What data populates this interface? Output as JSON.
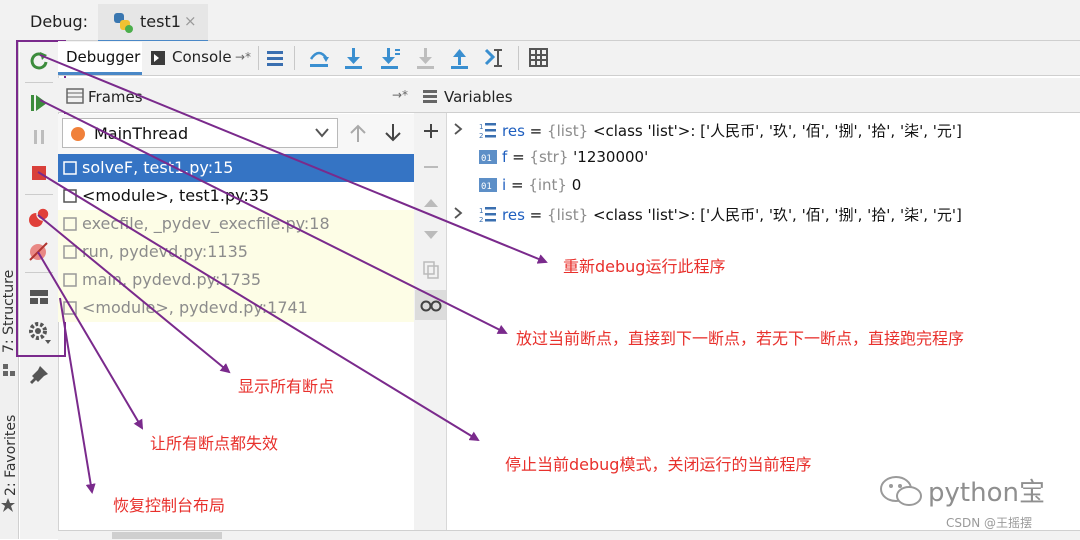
{
  "debug_bar": {
    "label": "Debug:",
    "tab_title": "test1",
    "close_glyph": "×"
  },
  "left_strip": {
    "structure": "7: Structure",
    "favorites": "2: Favorites"
  },
  "toolbar": {
    "debugger_tab": "Debugger",
    "console_tab": "Console",
    "console_pin": "→*"
  },
  "frames": {
    "title": "Frames",
    "pin": "→*",
    "thread": "MainThread",
    "items": [
      "solveF, test1.py:15",
      "<module>, test1.py:35",
      "execfile, _pydev_execfile.py:18",
      "run, pydevd.py:1135",
      "main, pydevd.py:1735",
      "<module>, pydevd.py:1741"
    ]
  },
  "variables": {
    "title": "Variables",
    "rows": [
      {
        "name": "res",
        "type": "{list}",
        "value": "<class 'list'>: ['人民币', '玖', '佰', '捌', '拾', '柒', '元']",
        "expandable": true
      },
      {
        "name": "f",
        "type": "{str}",
        "value": "'1230000'",
        "expandable": false
      },
      {
        "name": "i",
        "type": "{int}",
        "value": "0",
        "expandable": false
      },
      {
        "name": "res",
        "type": "{list}",
        "value": "<class 'list'>: ['人民币', '玖', '佰', '捌', '拾', '柒', '元']",
        "expandable": true
      }
    ],
    "equals": "="
  },
  "annotations": {
    "rerun": "重新debug运行此程序",
    "resume": "放过当前断点，直接到下一断点，若无下一断点，直接跑完程序",
    "view_breakpoints": "显示所有断点",
    "mute_breakpoints": "让所有断点都失效",
    "stop": "停止当前debug模式，关闭运行的当前程序",
    "restore_layout": "恢复控制台布局"
  },
  "watermark": {
    "brand": "python宝",
    "credit": "CSDN @王摇摆"
  },
  "colors": {
    "selection": "#3574c4",
    "annotation_red": "#e8302c",
    "arrow_purple": "#7a2a8c",
    "library_frame_bg": "#fdfde6"
  }
}
